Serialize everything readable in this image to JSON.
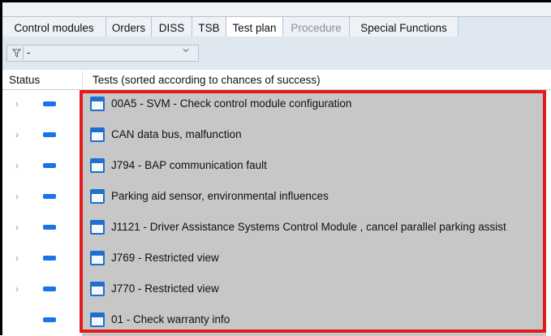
{
  "tabs": [
    {
      "label": "Control modules",
      "state": "normal"
    },
    {
      "label": "Orders",
      "state": "normal"
    },
    {
      "label": "DISS",
      "state": "normal"
    },
    {
      "label": "TSB",
      "state": "normal"
    },
    {
      "label": "Test plan",
      "state": "active"
    },
    {
      "label": "Procedure",
      "state": "disabled"
    },
    {
      "label": "Special Functions",
      "state": "normal"
    }
  ],
  "filter": {
    "icon": "filter-icon",
    "value": "-",
    "chevron": "chevron-down-icon"
  },
  "columns": {
    "status": "Status",
    "tests": "Tests (sorted according to chances of success)"
  },
  "rows": [
    {
      "label": "00A5 - SVM - Check control module configuration",
      "expandable": true
    },
    {
      "label": "CAN data bus, malfunction",
      "expandable": true
    },
    {
      "label": "J794 - BAP communication fault",
      "expandable": true
    },
    {
      "label": "Parking aid sensor, environmental influences",
      "expandable": true
    },
    {
      "label": "J1121 - Driver Assistance Systems Control Module , cancel parallel parking assist",
      "expandable": true
    },
    {
      "label": "J769 - Restricted view",
      "expandable": true
    },
    {
      "label": "J770 - Restricted view",
      "expandable": true
    },
    {
      "label": "01 - Check warranty info",
      "expandable": false
    }
  ],
  "colors": {
    "status_indicator": "#1a73e8",
    "highlight_border": "#e31b1b",
    "row_background": "#c7c7c7"
  },
  "icons": {
    "expand": "chevron-right-icon",
    "status": "status-indicator-icon",
    "test": "test-document-icon"
  }
}
